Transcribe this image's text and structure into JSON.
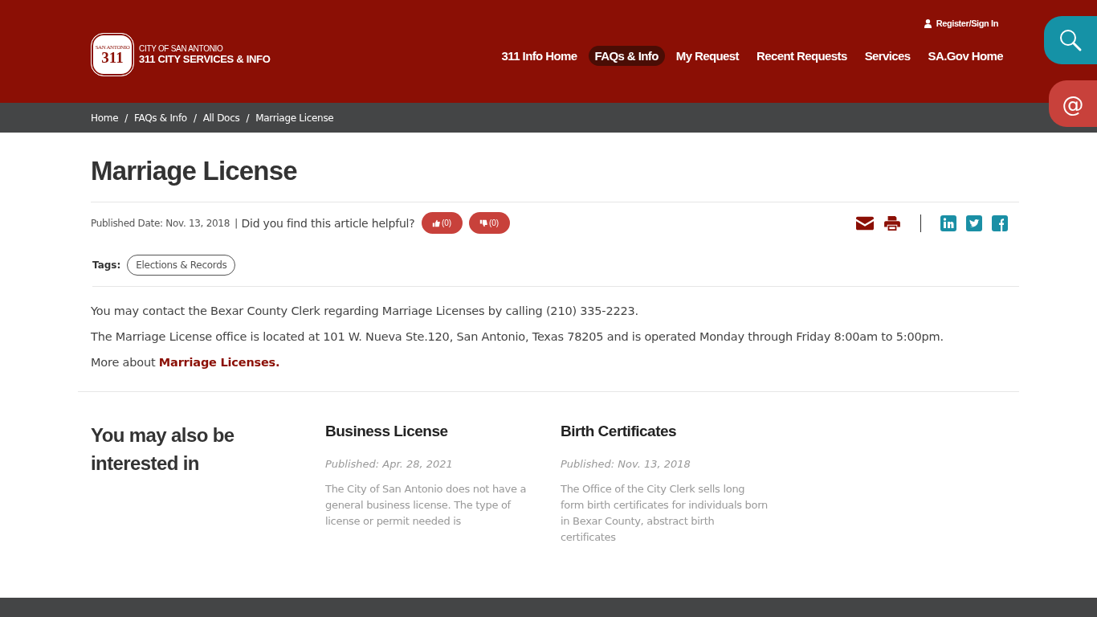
{
  "header": {
    "logo": {
      "badge_top": "SAN ANTONIO",
      "badge_number": "311",
      "line_1": "CITY OF SAN ANTONIO",
      "line_2": "311 CITY SERVICES & INFO"
    },
    "account_link": "Register/Sign In",
    "nav": [
      {
        "label": "311 Info Home",
        "selected": false
      },
      {
        "label": "FAQs & Info",
        "selected": true
      },
      {
        "label": "My Request",
        "selected": false
      },
      {
        "label": "Recent Requests",
        "selected": false
      },
      {
        "label": "Services",
        "selected": false
      },
      {
        "label": "SA.Gov Home",
        "selected": false
      }
    ],
    "side_buttons": [
      {
        "kind": "search"
      },
      {
        "kind": "email",
        "label": "@"
      }
    ]
  },
  "breadcrumbs": {
    "separator": "/",
    "items": [
      "Home",
      "FAQs & Info",
      "All Docs",
      "Marriage License"
    ]
  },
  "article": {
    "title": "Marriage License",
    "published": "Published Date: Nov. 13, 2018",
    "separator": "|",
    "helpful_question": "Did you find this article helpful?",
    "votes": [
      {
        "kind": "up",
        "count": "(0)"
      },
      {
        "kind": "down",
        "count": "(0)"
      }
    ],
    "actions": [
      {
        "kind": "mail"
      },
      {
        "kind": "print"
      }
    ],
    "share": [
      {
        "kind": "linkedin"
      },
      {
        "kind": "twitter"
      },
      {
        "kind": "facebook"
      }
    ],
    "tags_label": "Tags:",
    "tags": [
      "Elections & Records"
    ],
    "paragraphs": [
      "You may contact the Bexar County Clerk regarding Marriage Licenses by calling (210) 335-2223.",
      "The Marriage License office is located at 101 W. Nueva Ste.120, San Antonio, Texas 78205 and is operated Monday through Friday 8:00am to 5:00pm."
    ],
    "more": {
      "text": "More about",
      "link": "Marriage Licenses."
    }
  },
  "related": {
    "heading": "You may also be interested in",
    "items": [
      {
        "title": "Business License",
        "published": "Published: Apr. 28, 2021",
        "summary": "The City of San Antonio does not have a general business license. The type of license or permit needed is"
      },
      {
        "title": "Birth Certificates",
        "published": "Published: Nov. 13, 2018",
        "summary": "The Office of the City Clerk sells long form birth certificates for individuals born in Bexar County, abstract birth certificates"
      }
    ]
  }
}
